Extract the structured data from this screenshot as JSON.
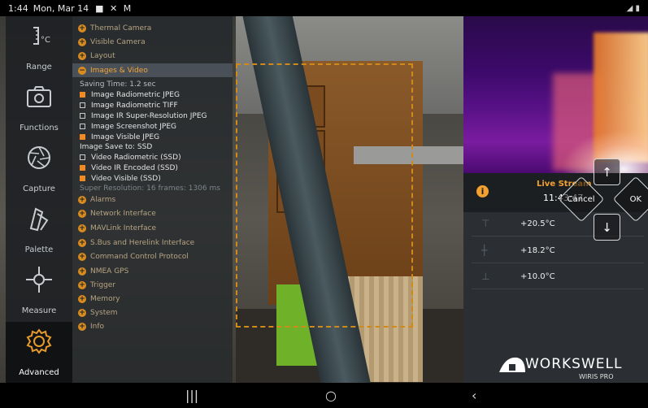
{
  "status_bar": {
    "time": "1:44",
    "date": "Mon, Mar 14",
    "icons": "■ ✕ M"
  },
  "sidebar": {
    "items": [
      {
        "label": "Range",
        "icon": "thermometer-icon"
      },
      {
        "label": "Functions",
        "icon": "camera-icon"
      },
      {
        "label": "Capture",
        "icon": "aperture-icon"
      },
      {
        "label": "Palette",
        "icon": "palette-icon"
      },
      {
        "label": "Measure",
        "icon": "crosshair-icon"
      },
      {
        "label": "Advanced",
        "icon": "gear-icon"
      }
    ],
    "range_unit": "°C"
  },
  "menu": {
    "sections_top": [
      "Thermal Camera",
      "Visible Camera",
      "Layout"
    ],
    "active_section": "Images & Video",
    "saving_time": "Saving Time: 1.2 sec",
    "image_options": [
      {
        "label": "Image Radiometric JPEG",
        "checked": true
      },
      {
        "label": "Image Radiometric TIFF",
        "checked": false
      },
      {
        "label": "Image IR Super-Resolution JPEG",
        "checked": false
      },
      {
        "label": "Image Screenshot JPEG",
        "checked": false
      },
      {
        "label": "Image Visible JPEG",
        "checked": true
      }
    ],
    "save_to": "Image Save to: SSD",
    "video_options": [
      {
        "label": "Video Radiometric (SSD)",
        "checked": false
      },
      {
        "label": "Video IR Encoded (SSD)",
        "checked": true
      },
      {
        "label": "Video Visible (SSD)",
        "checked": true
      }
    ],
    "super_resolution": "Super Resolution: 16 frames: 1306 ms",
    "sections_bottom": [
      "Alarms",
      "Network Interface",
      "MAVLink Interface",
      "S.Bus and Herelink Interface",
      "Command Control Protocol",
      "NMEA GPS",
      "Trigger",
      "Memory",
      "System",
      "Info"
    ]
  },
  "live": {
    "title": "Live Stream",
    "time": "11:43:47"
  },
  "controls": {
    "cancel": "Cancel",
    "ok": "OK",
    "up": "↑",
    "down": "↓"
  },
  "temperatures": [
    "+20.5°C",
    "+18.2°C",
    "+10.0°C"
  ],
  "logo": {
    "name": "WORKSWELL",
    "product": "WIRIS PRO"
  },
  "navbar": {
    "recent": "|||",
    "home": "○",
    "back": "‹"
  }
}
